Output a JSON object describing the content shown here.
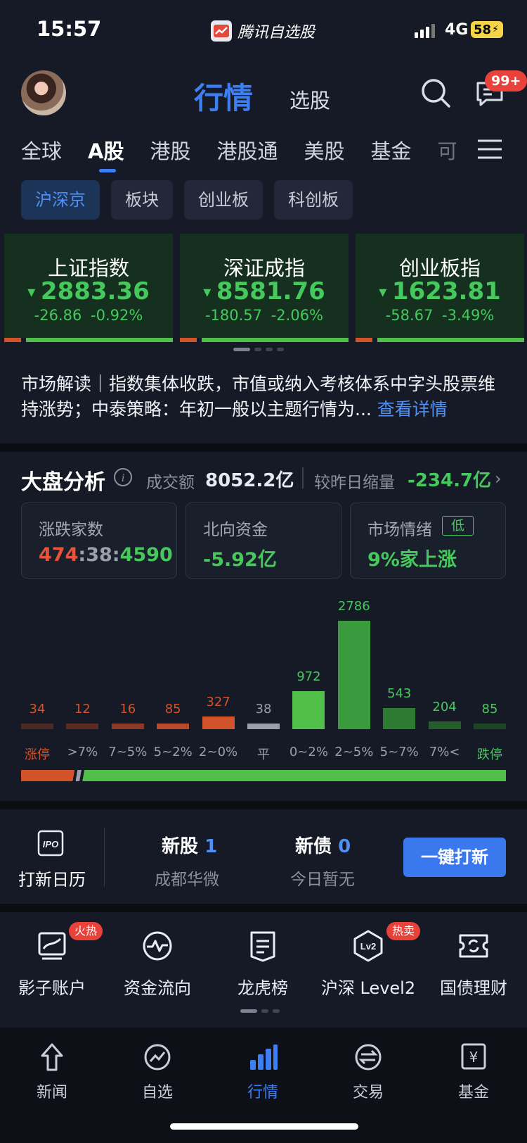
{
  "status": {
    "time": "15:57",
    "app_name": "腾讯自选股",
    "network": "4G",
    "battery": "58"
  },
  "header": {
    "active_tab": "行情",
    "other_tab": "选股",
    "badge": "99+"
  },
  "market_tabs": [
    "全球",
    "A股",
    "港股",
    "港股通",
    "美股",
    "基金",
    "可"
  ],
  "sub_tabs": [
    "沪深京",
    "板块",
    "创业板",
    "科创板"
  ],
  "indices": [
    {
      "name": "上证指数",
      "value": "2883.36",
      "change": "-26.86",
      "pct": "-0.92%"
    },
    {
      "name": "深证成指",
      "value": "8581.76",
      "change": "-180.57",
      "pct": "-2.06%"
    },
    {
      "name": "创业板指",
      "value": "1623.81",
      "change": "-58.67",
      "pct": "-3.49%"
    }
  ],
  "news": {
    "text": "市场解读｜指数集体收跌，市值或纳入考核体系中字头股票维持涨势；中泰策略：年初一般以主题行情为...",
    "link": "查看详情"
  },
  "analysis": {
    "title": "大盘分析",
    "volume_label": "成交额",
    "volume_value": "8052.2亿",
    "compare_label": "较昨日缩量",
    "compare_value": "-234.7亿",
    "boxes": {
      "updown_label": "涨跌家数",
      "up": "474",
      "flat": "38",
      "down": "4590",
      "northbound_label": "北向资金",
      "northbound_value": "-5.92亿",
      "sentiment_label": "市场情绪",
      "sentiment_tag": "低",
      "sentiment_value": "9%家上涨"
    },
    "histogram": {
      "labels": [
        "涨停",
        ">7%",
        "7~5%",
        "5~2%",
        "2~0%",
        "平",
        "0~2%",
        "2~5%",
        "5~7%",
        "7%<",
        "跌停"
      ],
      "values": [
        34,
        12,
        16,
        85,
        327,
        38,
        972,
        2786,
        543,
        204,
        85
      ],
      "colors": [
        "#4a2a22",
        "#5c2c22",
        "#8a3a26",
        "#b8492a",
        "#d2522a",
        "#9aa0ab",
        "#4fbf4a",
        "#3a9a3d",
        "#2d7a32",
        "#245e2a",
        "#1d4424"
      ],
      "value_colors": [
        "#d2522a",
        "#d2522a",
        "#d2522a",
        "#d2522a",
        "#d2522a",
        "#9aa0ab",
        "#45c95c",
        "#45c95c",
        "#45c95c",
        "#45c95c",
        "#45c95c"
      ]
    }
  },
  "ipo": {
    "calendar_label": "打新日历",
    "new_stock_label": "新股",
    "new_stock_count": "1",
    "new_stock_name": "成都华微",
    "new_bond_label": "新债",
    "new_bond_count": "0",
    "new_bond_name": "今日暂无",
    "apply_button": "一键打新"
  },
  "tools": [
    {
      "label": "影子账户",
      "badge": "火热"
    },
    {
      "label": "资金流向",
      "badge": ""
    },
    {
      "label": "龙虎榜",
      "badge": ""
    },
    {
      "label": "沪深 Level2",
      "badge": "热卖"
    },
    {
      "label": "国债理财",
      "badge": ""
    }
  ],
  "nav": [
    "新闻",
    "自选",
    "行情",
    "交易",
    "基金"
  ],
  "colors": {
    "accent": "#3d7ff2",
    "down": "#45c95c",
    "up": "#d2522a"
  }
}
